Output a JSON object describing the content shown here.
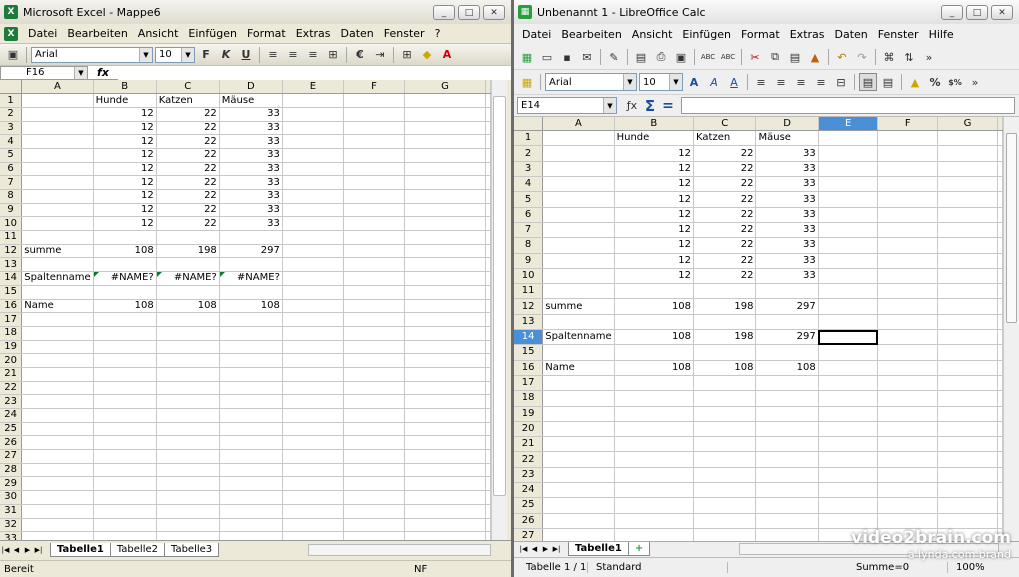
{
  "excel": {
    "title": "Microsoft Excel - Mappe6",
    "menu": [
      "Datei",
      "Bearbeiten",
      "Ansicht",
      "Einfügen",
      "Format",
      "Extras",
      "Daten",
      "Fenster",
      "?"
    ],
    "font": "Arial",
    "size": "10",
    "name_box": "F16",
    "fx": "fx",
    "columns": [
      "A",
      "B",
      "C",
      "D",
      "E",
      "F",
      "G"
    ],
    "rows": [
      [
        "1",
        "",
        "Hunde",
        "Katzen",
        "Mäuse",
        "",
        "",
        ""
      ],
      [
        "2",
        "",
        "12",
        "22",
        "33",
        "",
        "",
        ""
      ],
      [
        "3",
        "",
        "12",
        "22",
        "33",
        "",
        "",
        ""
      ],
      [
        "4",
        "",
        "12",
        "22",
        "33",
        "",
        "",
        ""
      ],
      [
        "5",
        "",
        "12",
        "22",
        "33",
        "",
        "",
        ""
      ],
      [
        "6",
        "",
        "12",
        "22",
        "33",
        "",
        "",
        ""
      ],
      [
        "7",
        "",
        "12",
        "22",
        "33",
        "",
        "",
        ""
      ],
      [
        "8",
        "",
        "12",
        "22",
        "33",
        "",
        "",
        ""
      ],
      [
        "9",
        "",
        "12",
        "22",
        "33",
        "",
        "",
        ""
      ],
      [
        "10",
        "",
        "12",
        "22",
        "33",
        "",
        "",
        ""
      ],
      [
        "11",
        "",
        "",
        "",
        "",
        "",
        "",
        ""
      ],
      [
        "12",
        "summe",
        "108",
        "198",
        "297",
        "",
        "",
        ""
      ],
      [
        "13",
        "",
        "",
        "",
        "",
        "",
        "",
        ""
      ],
      [
        "14",
        "Spaltenname",
        "#NAME?",
        "#NAME?",
        "#NAME?",
        "",
        "",
        ""
      ],
      [
        "15",
        "",
        "",
        "",
        "",
        "",
        "",
        ""
      ],
      [
        "16",
        "Name",
        "108",
        "108",
        "108",
        "",
        "",
        ""
      ],
      [
        "17",
        "",
        "",
        "",
        "",
        "",
        "",
        ""
      ],
      [
        "18",
        "",
        "",
        "",
        "",
        "",
        "",
        ""
      ],
      [
        "19",
        "",
        "",
        "",
        "",
        "",
        "",
        ""
      ],
      [
        "20",
        "",
        "",
        "",
        "",
        "",
        "",
        ""
      ],
      [
        "21",
        "",
        "",
        "",
        "",
        "",
        "",
        ""
      ],
      [
        "22",
        "",
        "",
        "",
        "",
        "",
        "",
        ""
      ],
      [
        "23",
        "",
        "",
        "",
        "",
        "",
        "",
        ""
      ],
      [
        "24",
        "",
        "",
        "",
        "",
        "",
        "",
        ""
      ],
      [
        "25",
        "",
        "",
        "",
        "",
        "",
        "",
        ""
      ],
      [
        "26",
        "",
        "",
        "",
        "",
        "",
        "",
        ""
      ],
      [
        "27",
        "",
        "",
        "",
        "",
        "",
        "",
        ""
      ],
      [
        "28",
        "",
        "",
        "",
        "",
        "",
        "",
        ""
      ],
      [
        "29",
        "",
        "",
        "",
        "",
        "",
        "",
        ""
      ],
      [
        "30",
        "",
        "",
        "",
        "",
        "",
        "",
        ""
      ],
      [
        "31",
        "",
        "",
        "",
        "",
        "",
        "",
        ""
      ],
      [
        "32",
        "",
        "",
        "",
        "",
        "",
        "",
        ""
      ],
      [
        "33",
        "",
        "",
        "",
        "",
        "",
        "",
        ""
      ]
    ],
    "tabs": [
      "Tabelle1",
      "Tabelle2",
      "Tabelle3"
    ],
    "status_left": "Bereit",
    "status_right": "NF"
  },
  "calc": {
    "title": "Unbenannt 1 - LibreOffice Calc",
    "menu": [
      "Datei",
      "Bearbeiten",
      "Ansicht",
      "Einfügen",
      "Format",
      "Extras",
      "Daten",
      "Fenster",
      "Hilfe"
    ],
    "font": "Arial",
    "size": "10",
    "name_box": "E14",
    "columns": [
      "A",
      "B",
      "C",
      "D",
      "E",
      "F",
      "G"
    ],
    "rows": [
      [
        "1",
        "",
        "Hunde",
        "Katzen",
        "Mäuse",
        "",
        "",
        ""
      ],
      [
        "2",
        "",
        "12",
        "22",
        "33",
        "",
        "",
        ""
      ],
      [
        "3",
        "",
        "12",
        "22",
        "33",
        "",
        "",
        ""
      ],
      [
        "4",
        "",
        "12",
        "22",
        "33",
        "",
        "",
        ""
      ],
      [
        "5",
        "",
        "12",
        "22",
        "33",
        "",
        "",
        ""
      ],
      [
        "6",
        "",
        "12",
        "22",
        "33",
        "",
        "",
        ""
      ],
      [
        "7",
        "",
        "12",
        "22",
        "33",
        "",
        "",
        ""
      ],
      [
        "8",
        "",
        "12",
        "22",
        "33",
        "",
        "",
        ""
      ],
      [
        "9",
        "",
        "12",
        "22",
        "33",
        "",
        "",
        ""
      ],
      [
        "10",
        "",
        "12",
        "22",
        "33",
        "",
        "",
        ""
      ],
      [
        "11",
        "",
        "",
        "",
        "",
        "",
        "",
        ""
      ],
      [
        "12",
        "summe",
        "108",
        "198",
        "297",
        "",
        "",
        ""
      ],
      [
        "13",
        "",
        "",
        "",
        "",
        "",
        "",
        ""
      ],
      [
        "14",
        "Spaltenname",
        "108",
        "198",
        "297",
        "",
        "",
        ""
      ],
      [
        "15",
        "",
        "",
        "",
        "",
        "",
        "",
        ""
      ],
      [
        "16",
        "Name",
        "108",
        "108",
        "108",
        "",
        "",
        ""
      ],
      [
        "17",
        "",
        "",
        "",
        "",
        "",
        "",
        ""
      ],
      [
        "18",
        "",
        "",
        "",
        "",
        "",
        "",
        ""
      ],
      [
        "19",
        "",
        "",
        "",
        "",
        "",
        "",
        ""
      ],
      [
        "20",
        "",
        "",
        "",
        "",
        "",
        "",
        ""
      ],
      [
        "21",
        "",
        "",
        "",
        "",
        "",
        "",
        ""
      ],
      [
        "22",
        "",
        "",
        "",
        "",
        "",
        "",
        ""
      ],
      [
        "23",
        "",
        "",
        "",
        "",
        "",
        "",
        ""
      ],
      [
        "24",
        "",
        "",
        "",
        "",
        "",
        "",
        ""
      ],
      [
        "25",
        "",
        "",
        "",
        "",
        "",
        "",
        ""
      ],
      [
        "26",
        "",
        "",
        "",
        "",
        "",
        "",
        ""
      ],
      [
        "27",
        "",
        "",
        "",
        "",
        "",
        "",
        ""
      ]
    ],
    "tabs": [
      "Tabelle1"
    ],
    "status": [
      "Tabelle 1 / 1",
      "Standard",
      "Summe=0",
      "100%"
    ]
  },
  "watermark": {
    "line1": "video2brain.com",
    "line2": "a lynda.com brand"
  },
  "colors": {
    "excel_green": "#1d7a3a",
    "calc_selected_header": "#4a90d9",
    "error_triangle": "#0a7a33"
  }
}
